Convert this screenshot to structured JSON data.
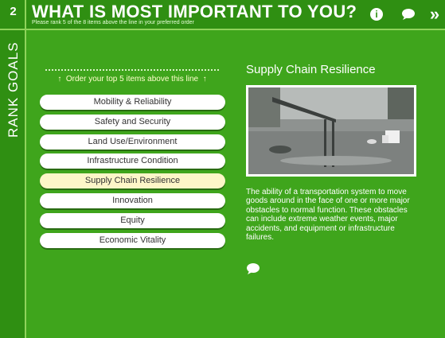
{
  "rail": {
    "step": "2",
    "title": "RANK GOALS"
  },
  "header": {
    "title": "WHAT IS MOST IMPORTANT TO YOU?",
    "subtitle": "Please rank 5 of the 8 items above the line in your preferred order",
    "forward_glyph": "»",
    "info_glyph": "i"
  },
  "instruction": "Order your top 5 items above this line",
  "items": [
    "Mobility & Reliability",
    "Safety and Security",
    "Land Use/Environment",
    "Infrastructure Condition",
    "Supply Chain Resilience",
    "Innovation",
    "Equity",
    "Economic Vitality"
  ],
  "selected_index": 4,
  "detail": {
    "title": "Supply Chain Resilience",
    "description": "The ability of a transportation system to move goods around in the face of one or more major obstacles to normal function. These obstacles can include extreme weather events, major accidents, and equipment or infrastructure failures."
  },
  "colors": {
    "background": "#3fa51c",
    "header": "#2f8f12",
    "selected_item": "#fdf6c8"
  }
}
